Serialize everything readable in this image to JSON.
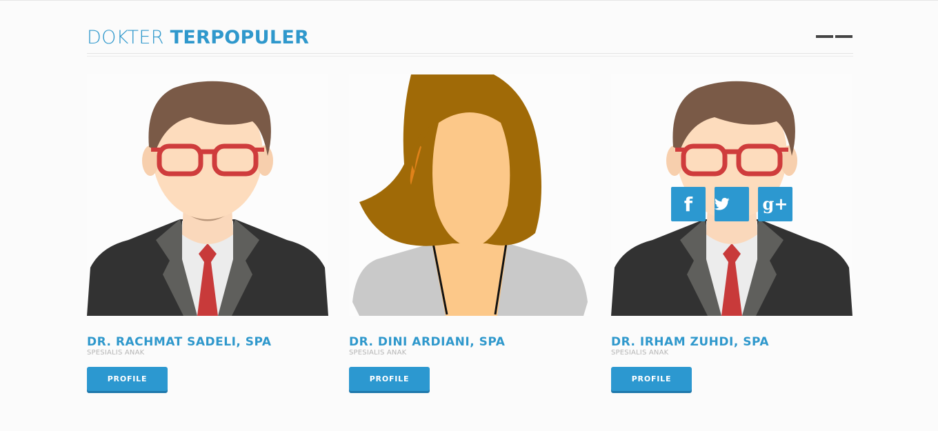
{
  "section": {
    "title_light": "DOKTER",
    "title_bold": "TERPOPULER"
  },
  "doctors": [
    {
      "name": "DR. RACHMAT SADELI, SPA",
      "specialty": "SPESIALIS ANAK",
      "button_label": "PROFILE",
      "avatar": "male-doctor-avatar"
    },
    {
      "name": "DR. DINI ARDIANI, SPA",
      "specialty": "SPESIALIS ANAK",
      "button_label": "PROFILE",
      "avatar": "female-doctor-avatar"
    },
    {
      "name": "DR. IRHAM ZUHDI, SPA",
      "specialty": "SPESIALIS ANAK",
      "button_label": "PROFILE",
      "avatar": "male-doctor-avatar"
    }
  ],
  "social_overlay": {
    "facebook_glyph": "f",
    "google_glyph": "g+",
    "icons": [
      "facebook-icon",
      "twitter-icon",
      "google-plus-icon"
    ]
  },
  "colors": {
    "accent": "#2f98cc",
    "button": "#2c98d0",
    "muted_text": "#b5b5b5"
  }
}
